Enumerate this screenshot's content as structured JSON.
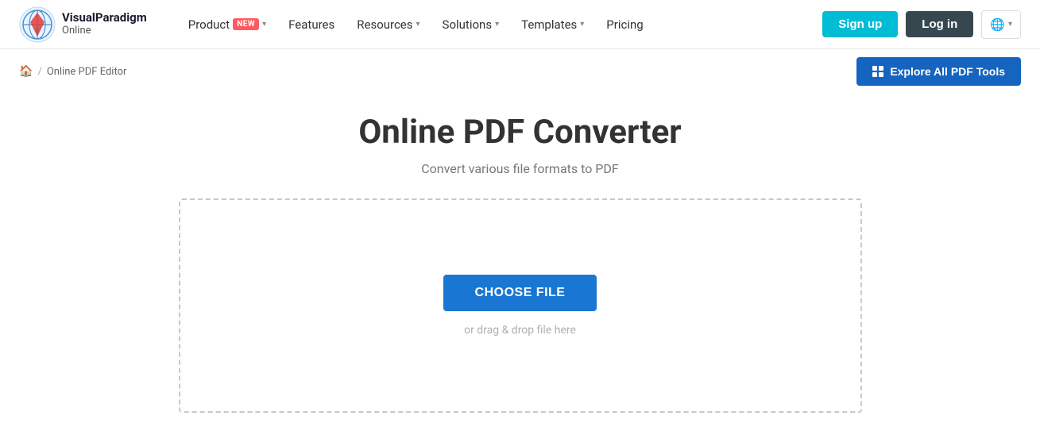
{
  "brand": {
    "name": "VisualParadigm",
    "sub": "Online"
  },
  "nav": {
    "product_label": "Product",
    "product_badge": "NEW",
    "features_label": "Features",
    "resources_label": "Resources",
    "solutions_label": "Solutions",
    "templates_label": "Templates",
    "pricing_label": "Pricing",
    "signup_label": "Sign up",
    "login_label": "Log in",
    "globe_label": "🌐"
  },
  "breadcrumb": {
    "home_icon": "🏠",
    "separator": "/",
    "current": "Online PDF Editor"
  },
  "explore_button": {
    "label": "Explore All PDF Tools"
  },
  "main": {
    "heading": "Online PDF Converter",
    "subtitle": "Convert various file formats to PDF",
    "choose_file_label": "CHOOSE FILE",
    "drag_drop_text": "or drag & drop file here"
  }
}
